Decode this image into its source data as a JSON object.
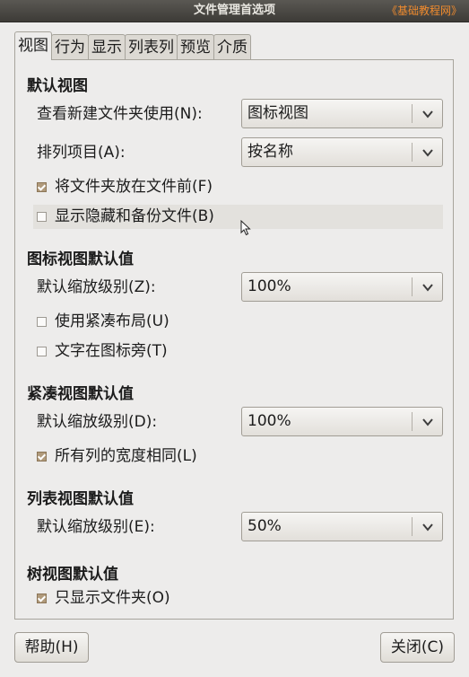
{
  "window": {
    "title": "文件管理首选项",
    "watermark": "《基础教程网》"
  },
  "tabs": [
    "视图",
    "行为",
    "显示",
    "列表列",
    "预览",
    "介质"
  ],
  "active_tab": "视图",
  "sections": {
    "default_view": {
      "title": "默认视图",
      "open_new_folders_label": "查看新建文件夹使用(N):",
      "open_new_folders_value": "图标视图",
      "arrange_items_label": "排列项目(A):",
      "arrange_items_value": "按名称",
      "folders_before_files": {
        "label": "将文件夹放在文件前(F)",
        "checked": true
      },
      "show_hidden_backup": {
        "label": "显示隐藏和备份文件(B)",
        "checked": false
      }
    },
    "icon_view_defaults": {
      "title": "图标视图默认值",
      "zoom_label": "默认缩放级别(Z):",
      "zoom_value": "100%",
      "compact_layout": {
        "label": "使用紧凑布局(U)",
        "checked": false
      },
      "text_beside_icons": {
        "label": "文字在图标旁(T)",
        "checked": false
      }
    },
    "compact_view_defaults": {
      "title": "紧凑视图默认值",
      "zoom_label": "默认缩放级别(D):",
      "zoom_value": "100%",
      "same_width_columns": {
        "label": "所有列的宽度相同(L)",
        "checked": true
      }
    },
    "list_view_defaults": {
      "title": "列表视图默认值",
      "zoom_label": "默认缩放级别(E):",
      "zoom_value": "50%"
    },
    "tree_view_defaults": {
      "title": "树视图默认值",
      "only_folders": {
        "label": "只显示文件夹(O)",
        "checked": true
      }
    }
  },
  "buttons": {
    "help": "帮助(H)",
    "close": "关闭(C)"
  }
}
